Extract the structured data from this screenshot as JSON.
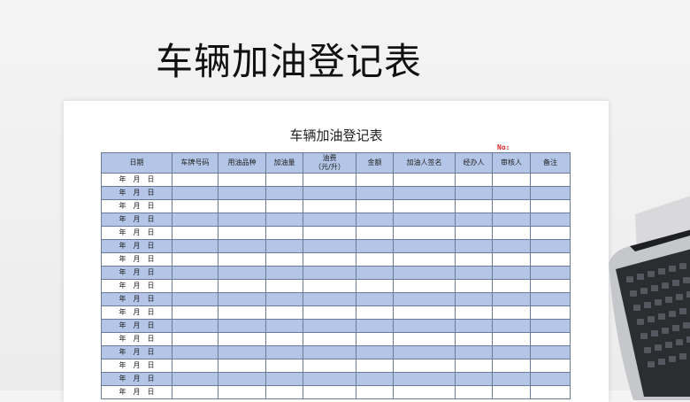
{
  "banner": {
    "title": "车辆加油登记表"
  },
  "document": {
    "title": "车辆加油登记表",
    "no_label": "No:",
    "columns": [
      "日期",
      "车牌号码",
      "用油品种",
      "加油量",
      "油费\n（元/升）",
      "金额",
      "加油人签名",
      "经办人",
      "审核人",
      "备注"
    ],
    "date_placeholder": "年　月　日",
    "row_count": 17
  },
  "colors": {
    "header_fill": "#b4c6e7",
    "alt_row_fill": "#b4c6e7",
    "no_label": "#e02020"
  },
  "icons": {
    "laptop": "laptop-icon"
  }
}
